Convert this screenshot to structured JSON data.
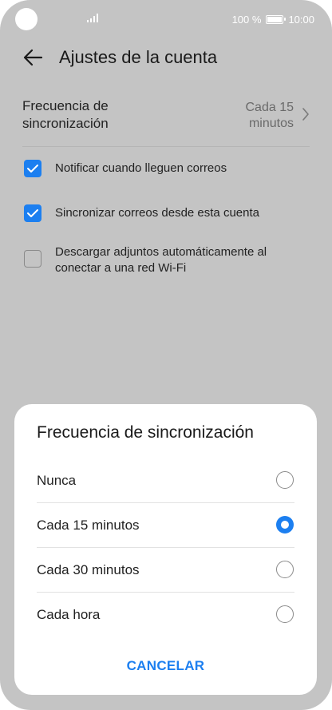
{
  "status_bar": {
    "battery_text": "100 %",
    "time": "10:00"
  },
  "header": {
    "title": "Ajustes de la cuenta"
  },
  "sync_frequency": {
    "label": "Frecuencia de\nsincronización",
    "value": "Cada 15\nminutos"
  },
  "checkboxes": [
    {
      "label": "Notificar cuando lleguen correos",
      "checked": true
    },
    {
      "label": "Sincronizar correos desde esta cuenta",
      "checked": true
    },
    {
      "label": "Descargar adjuntos automáticamente al conectar a una red Wi-Fi",
      "checked": false
    }
  ],
  "dialog": {
    "title": "Frecuencia de sincronización",
    "options": [
      {
        "label": "Nunca",
        "selected": false
      },
      {
        "label": "Cada 15 minutos",
        "selected": true
      },
      {
        "label": "Cada 30 minutos",
        "selected": false
      },
      {
        "label": "Cada hora",
        "selected": false
      }
    ],
    "cancel_label": "CANCELAR"
  },
  "colors": {
    "accent": "#1c7ff0",
    "dim_background": "#c4c4c4"
  }
}
